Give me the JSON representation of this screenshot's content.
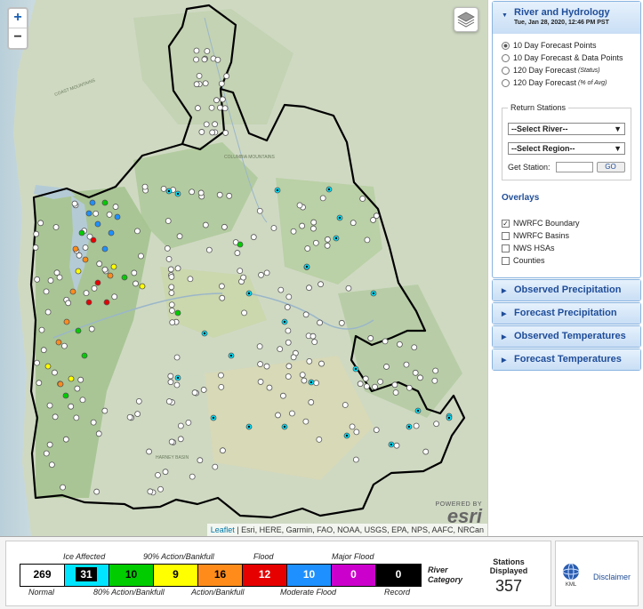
{
  "map": {
    "zoom_in": "+",
    "zoom_out": "−",
    "powered_by": "POWERED BY",
    "esri": "esri",
    "attribution_leaflet": "Leaflet",
    "attribution_rest": " | Esri, HERE, Garmin, FAO, NOAA, USGS, EPA, NPS, AAFC, NRCan",
    "labels": {
      "coast_mountains": "COAST MOUNTAINS",
      "columbia_mountains": "COLUMBIA MOUNTAINS",
      "harney_basin": "HARNEY BASIN"
    },
    "status_colors": {
      "normal": "#ffffff",
      "ice": "#00e5ff",
      "action80": "#00cc00",
      "bankfull90": "#ffff00",
      "action": "#ff8c1a",
      "flood": "#e60000",
      "moderate": "#1e90ff",
      "major": "#cc00cc",
      "record": "#000000"
    }
  },
  "panel": {
    "river": {
      "title": "River and Hydrology",
      "datetime": "Tue, Jan 28, 2020, 12:46 PM PST",
      "options": [
        {
          "label": "10 Day Forecast Points",
          "note": "",
          "selected": true
        },
        {
          "label": "10 Day Forecast & Data Points",
          "note": "",
          "selected": false
        },
        {
          "label": "120 Day Forecast",
          "note": "(Status)",
          "selected": false
        },
        {
          "label": "120 Day Forecast",
          "note": "(% of Avg)",
          "selected": false
        }
      ],
      "return_stations": {
        "legend": "Return Stations",
        "select_river": "--Select River--",
        "select_region": "--Select Region--",
        "get_station_label": "Get Station:",
        "go": "GO"
      },
      "overlays_title": "Overlays",
      "overlays": [
        {
          "label": "NWRFC Boundary",
          "checked": true
        },
        {
          "label": "NWRFC Basins",
          "checked": false
        },
        {
          "label": "NWS HSAs",
          "checked": false
        },
        {
          "label": "Counties",
          "checked": false
        }
      ]
    },
    "sections": [
      "Observed Precipitation",
      "Forecast Precipitation",
      "Observed Temperatures",
      "Forecast Temperatures"
    ]
  },
  "legend": {
    "cells": [
      {
        "value": "269",
        "bg": "#ffffff",
        "fg": "#000000"
      },
      {
        "value": "31",
        "bg": "#00e5ff",
        "fg": "#ffffff"
      },
      {
        "value": "10",
        "bg": "#00cc00",
        "fg": "#000000"
      },
      {
        "value": "9",
        "bg": "#ffff00",
        "fg": "#000000"
      },
      {
        "value": "16",
        "bg": "#ff8c1a",
        "fg": "#000000"
      },
      {
        "value": "12",
        "bg": "#e60000",
        "fg": "#ffffff"
      },
      {
        "value": "10",
        "bg": "#1e90ff",
        "fg": "#ffffff"
      },
      {
        "value": "0",
        "bg": "#cc00cc",
        "fg": "#ffffff"
      },
      {
        "value": "0",
        "bg": "#000000",
        "fg": "#ffffff"
      }
    ],
    "top_labels": [
      "Ice Affected",
      "90% Action/Bankfull",
      "Flood",
      "Major Flood"
    ],
    "bottom_labels": [
      "Normal",
      "80% Action/Bankfull",
      "Action/Bankfull",
      "Moderate Flood",
      "Record"
    ],
    "river_category": [
      "River",
      "Category"
    ],
    "stations_title": [
      "Stations",
      "Displayed"
    ],
    "stations_count": "357",
    "disclaimer": "Disclaimer",
    "kml": "KML"
  }
}
